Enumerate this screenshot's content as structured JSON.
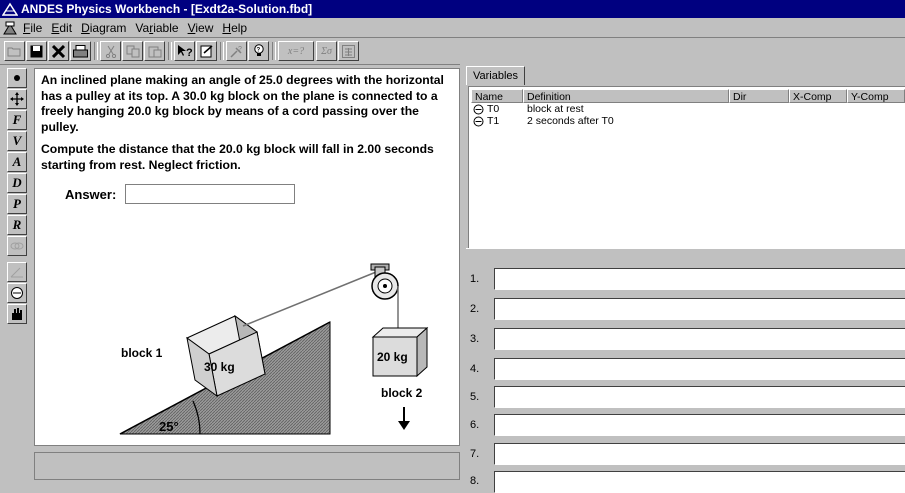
{
  "window": {
    "title": "ANDES Physics Workbench - [Exdt2a-Solution.fbd]"
  },
  "menu": [
    {
      "ul": "F",
      "rest": "ile"
    },
    {
      "ul": "E",
      "rest": "dit"
    },
    {
      "ul": "D",
      "rest": "iagram"
    },
    {
      "pre": "Va",
      "ul": "r",
      "rest": "iable"
    },
    {
      "ul": "V",
      "rest": "iew"
    },
    {
      "ul": "H",
      "rest": "elp"
    }
  ],
  "toolbar": {
    "icons": [
      "open-folder-icon",
      "save-icon",
      "delete-icon",
      "print-icon",
      "cut-icon",
      "copy-icon",
      "paste-icon",
      "context-help-icon",
      "review-icon",
      "hint-icon",
      "lightbulb-icon",
      "solve-for-icon",
      "sum-icon",
      "calculator-icon"
    ],
    "solve_label": "x=?",
    "sum_label": "Σσ"
  },
  "left_tools": {
    "force_labels": [
      "F",
      "V",
      "A",
      "D",
      "P",
      "R"
    ]
  },
  "problem": {
    "paragraph1": "An inclined plane making an angle of 25.0 degrees with the horizontal has a pulley at its top. A 30.0 kg block on the plane is connected to a freely hanging 20.0 kg block by means of a cord passing over the pulley.",
    "paragraph2": "Compute the distance that the 20.0 kg block will fall in 2.00 seconds starting from rest. Neglect friction.",
    "answer_label": "Answer:",
    "answer_value": ""
  },
  "diagram": {
    "block1_label": "block 1",
    "block1_mass": "30 kg",
    "block2_label": "block 2",
    "block2_mass": "20 kg",
    "angle_label": "25°"
  },
  "variables": {
    "tab": "Variables",
    "columns": [
      "Name",
      "Definition",
      "Dir",
      "X-Comp",
      "Y-Comp"
    ],
    "rows": [
      {
        "name": "T0",
        "definition": "block at rest"
      },
      {
        "name": "T1",
        "definition": "2 seconds after T0"
      }
    ]
  },
  "equations": {
    "numbers": [
      "1.",
      "2.",
      "3.",
      "4.",
      "5.",
      "6.",
      "7.",
      "8."
    ]
  }
}
